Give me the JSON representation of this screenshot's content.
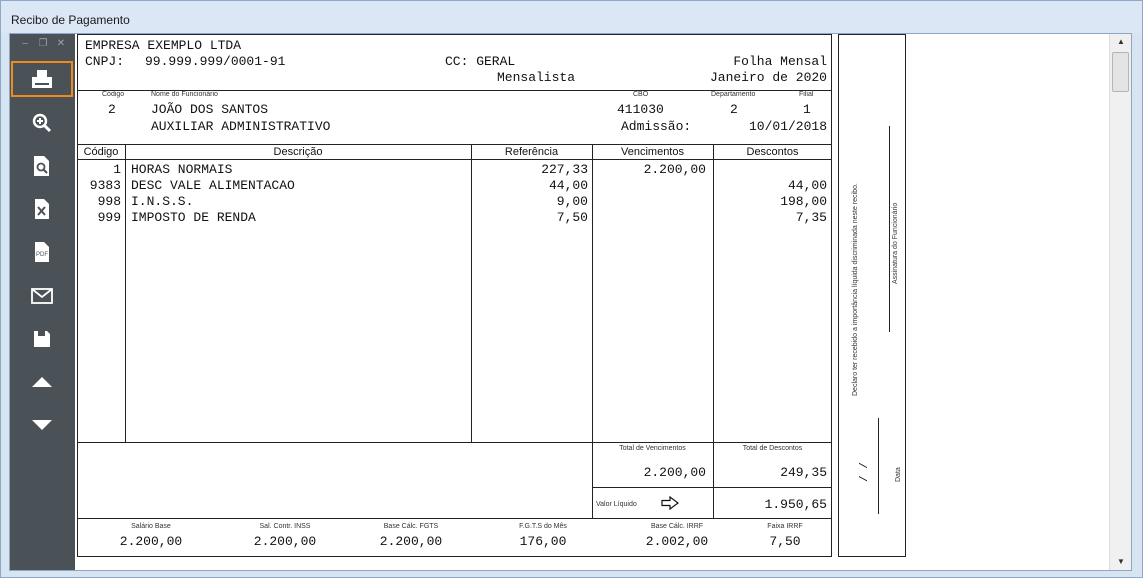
{
  "window": {
    "title": "Recibo de Pagamento"
  },
  "sidebar": {
    "controls": [
      "–",
      "❐",
      "✕"
    ],
    "buttons": [
      {
        "icon": "printer-icon"
      },
      {
        "icon": "zoom-in-icon"
      },
      {
        "icon": "preview-icon"
      },
      {
        "icon": "excel-icon"
      },
      {
        "icon": "pdf-icon",
        "text": "PDF"
      },
      {
        "icon": "email-icon"
      },
      {
        "icon": "save-icon"
      },
      {
        "icon": "page-up-icon"
      },
      {
        "icon": "page-down-icon"
      }
    ]
  },
  "company": {
    "name": "EMPRESA EXEMPLO LTDA",
    "cnpj_label": "CNPJ:",
    "cnpj": "99.999.999/0001-91",
    "cc": "CC: GERAL",
    "folha": "Folha Mensal",
    "tipo": "Mensalista",
    "periodo": "Janeiro de 2020"
  },
  "employee": {
    "labels": {
      "codigo": "Código",
      "nome": "Nome do Funcionário",
      "cbo": "CBO",
      "departamento": "Departamento",
      "filial": "Filial"
    },
    "codigo": "2",
    "nome": "JOÃO DOS SANTOS",
    "cargo": "AUXILIAR ADMINISTRATIVO",
    "cbo": "411030",
    "departamento": "2",
    "filial": "1",
    "admissao_label": "Admissão:",
    "admissao": "10/01/2018"
  },
  "table": {
    "headers": [
      "Código",
      "Descrição",
      "Referência",
      "Vencimentos",
      "Descontos"
    ],
    "rows": [
      {
        "codigo": "1",
        "descricao": "HORAS NORMAIS",
        "referencia": "227,33",
        "vencimentos": "2.200,00",
        "descontos": ""
      },
      {
        "codigo": "9383",
        "descricao": "DESC VALE ALIMENTACAO",
        "referencia": "44,00",
        "vencimentos": "",
        "descontos": "44,00"
      },
      {
        "codigo": "998",
        "descricao": "I.N.S.S.",
        "referencia": "9,00",
        "vencimentos": "",
        "descontos": "198,00"
      },
      {
        "codigo": "999",
        "descricao": "IMPOSTO DE RENDA",
        "referencia": "7,50",
        "vencimentos": "",
        "descontos": "7,35"
      }
    ]
  },
  "totals": {
    "vencimentos_label": "Total de Vencimentos",
    "vencimentos": "2.200,00",
    "descontos_label": "Total de Descontos",
    "descontos": "249,35",
    "liquido_label": "Valor Líquido",
    "liquido": "1.950,65"
  },
  "bases": [
    {
      "label": "Salário Base",
      "value": "2.200,00"
    },
    {
      "label": "Sal. Contr. INSS",
      "value": "2.200,00"
    },
    {
      "label": "Base Cálc. FGTS",
      "value": "2.200,00"
    },
    {
      "label": "F.G.T.S do Mês",
      "value": "176,00"
    },
    {
      "label": "Base Cálc. IRRF",
      "value": "2.002,00"
    },
    {
      "label": "Faixa IRRF",
      "value": "7,50"
    }
  ],
  "receipt": {
    "declaracao": "Declaro ter recebido a importância líquida discriminada neste recibo.",
    "assinatura": "Assinatura do Funcionário",
    "data": "Data",
    "data_slashes": "/     /"
  }
}
